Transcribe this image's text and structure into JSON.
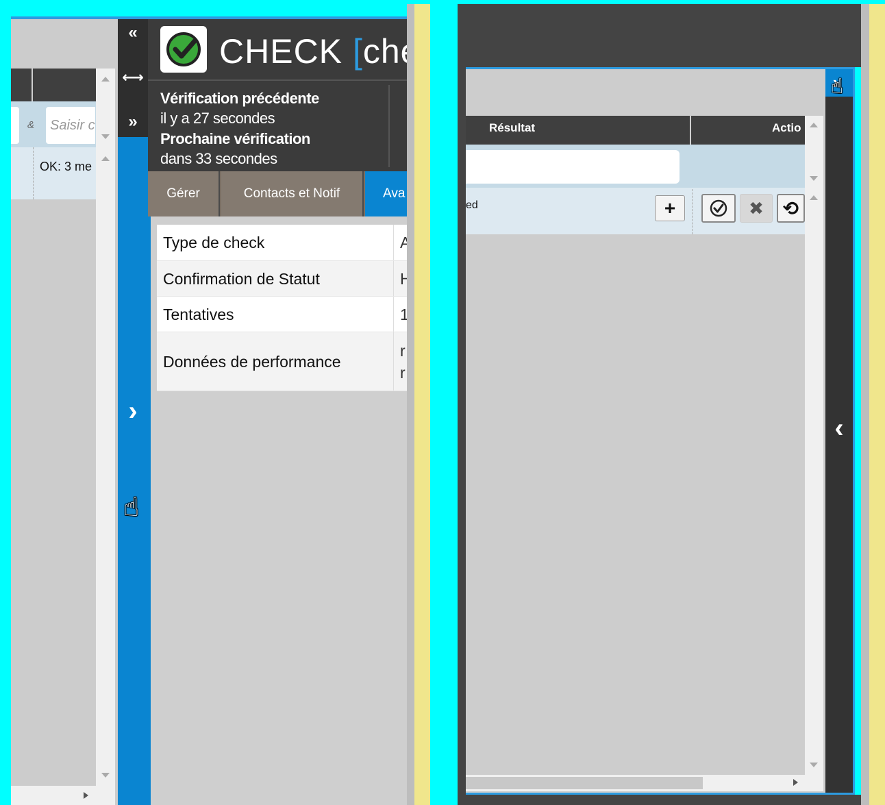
{
  "left": {
    "filter_amp": "&",
    "search_placeholder": "Saisir c",
    "row_text": "OK: 3 me",
    "strip": {
      "collapse_glyph": "«",
      "move_glyph": "⟷",
      "expand_glyph": "»",
      "nav_glyph": "›"
    },
    "detail": {
      "title": "CHECK",
      "title_open_bracket": "[",
      "title_suffix": "che",
      "lines": [
        {
          "text": "Vérification précédente",
          "bold": true
        },
        {
          "text": "il y a 27 secondes",
          "bold": false
        },
        {
          "text": "Prochaine vérification",
          "bold": true
        },
        {
          "text": "dans 33 secondes",
          "bold": false
        }
      ],
      "tabs": [
        {
          "label": "Gérer",
          "active": false
        },
        {
          "label": "Contacts et Notif",
          "active": false
        },
        {
          "label": "Ava",
          "active": true
        }
      ],
      "rows": [
        {
          "label": "Type de check",
          "value": "A"
        },
        {
          "label": "Confirmation de Statut",
          "value": "H"
        },
        {
          "label": "Tentatives",
          "value": "1"
        },
        {
          "label": "Données de performance",
          "value": "r"
        }
      ]
    }
  },
  "right": {
    "header_resultat": "Résultat",
    "header_action": "Actio",
    "row_text": "ed",
    "buttons": {
      "add": "+",
      "check": "✔",
      "tools": "✖",
      "reset": "⟲"
    },
    "collapse_glyph": "‹",
    "top_glyph": "›"
  },
  "colors": {
    "accent_blue": "#0a85d1",
    "frame_blue": "#2d9be0",
    "dark_header": "#3b3b3b",
    "tab_brown": "#847a70",
    "filter_bg": "#c5dae6",
    "row_bg": "#dde9f1",
    "canvas_cyan": "#00ffff",
    "canvas_yellow": "#f0e68c"
  }
}
